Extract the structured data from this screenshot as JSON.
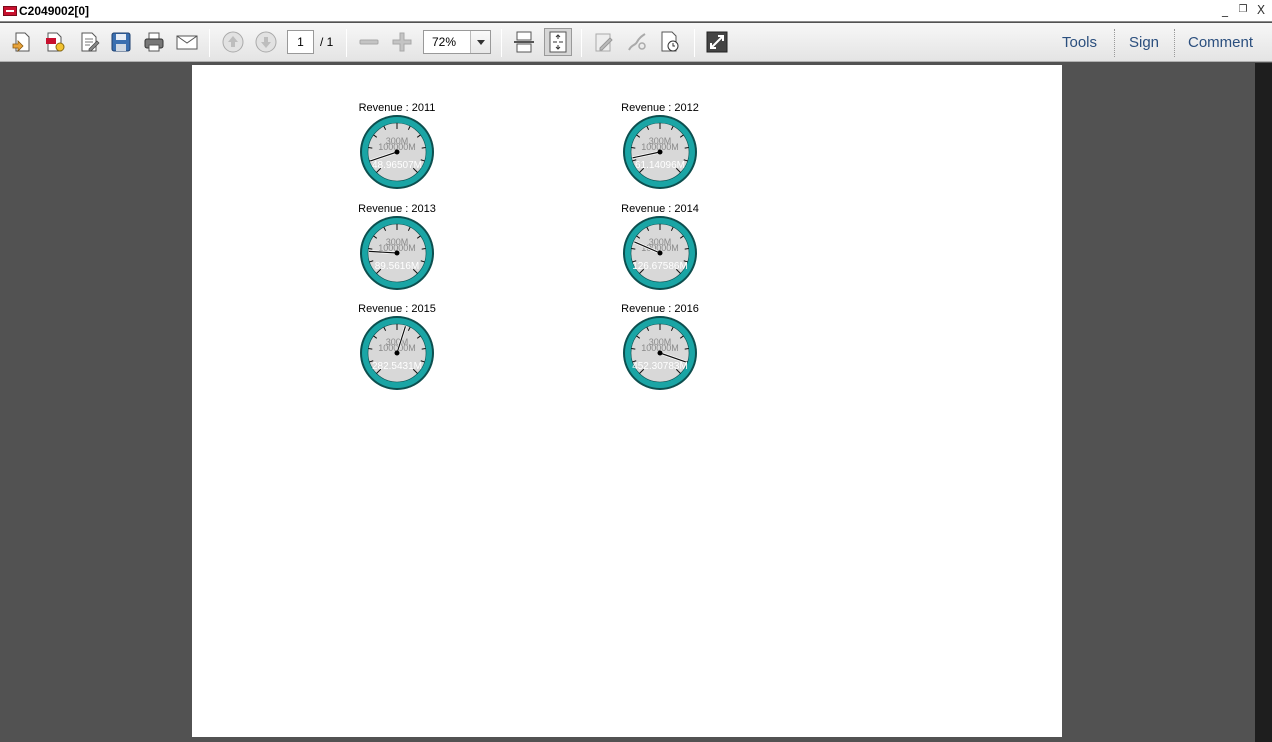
{
  "window": {
    "title": "C2049002[0]",
    "minimize": "_",
    "restore": "❐",
    "close": "X"
  },
  "toolbar": {
    "page_current": "1",
    "page_total": "/ 1",
    "zoom": "72%",
    "menu": {
      "tools": "Tools",
      "sign": "Sign",
      "comment": "Comment"
    }
  },
  "gauges": [
    {
      "title": "Revenue : 2011",
      "value": 48.965,
      "label": "48.96507M",
      "scale_upper": "300M",
      "scale_lower": "100000M"
    },
    {
      "title": "Revenue : 2012",
      "value": 61.14,
      "label": "61.14096M",
      "scale_upper": "300M",
      "scale_lower": "100000M"
    },
    {
      "title": "Revenue : 2013",
      "value": 89.56,
      "label": "89.5616M",
      "scale_upper": "300M",
      "scale_lower": "100000M"
    },
    {
      "title": "Revenue : 2014",
      "value": 126.68,
      "label": "126.67586M",
      "scale_upper": "300M",
      "scale_lower": "100000M"
    },
    {
      "title": "Revenue : 2015",
      "value": 282.54,
      "label": "282.5431M",
      "scale_upper": "300M",
      "scale_lower": "100000M"
    },
    {
      "title": "Revenue : 2016",
      "value": 452.31,
      "label": "452.30783M",
      "scale_upper": "300M",
      "scale_lower": "100000M"
    }
  ],
  "colors": {
    "gauge_ring": "#1aa5a5",
    "gauge_face": "#d8d8d8",
    "gauge_rim": "#0d4f4f"
  }
}
